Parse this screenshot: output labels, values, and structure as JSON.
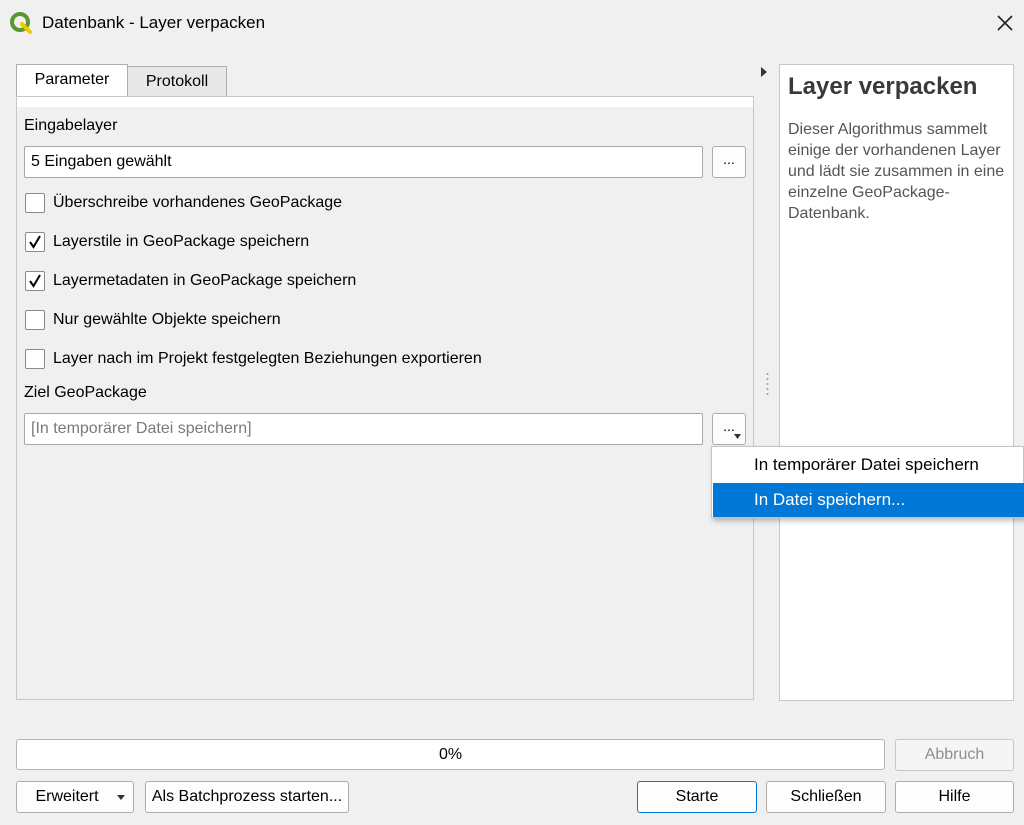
{
  "window": {
    "title": "Datenbank - Layer verpacken",
    "icon": "qgis-icon"
  },
  "tabs": [
    {
      "label": "Parameter",
      "active": true
    },
    {
      "label": "Protokoll",
      "active": false
    }
  ],
  "params": {
    "input_label": "Eingabelayer",
    "input_value": "5 Eingaben gewählt",
    "browse_label": "...",
    "checkboxes": [
      {
        "label": "Überschreibe vorhandenes GeoPackage",
        "checked": false
      },
      {
        "label": "Layerstile in GeoPackage speichern",
        "checked": true
      },
      {
        "label": "Layermetadaten in GeoPackage speichern",
        "checked": true
      },
      {
        "label": "Nur gewählte Objekte speichern",
        "checked": false
      },
      {
        "label": "Layer nach im Projekt festgelegten Beziehungen exportieren",
        "checked": false
      }
    ],
    "target_label": "Ziel GeoPackage",
    "target_placeholder": "[In temporärer Datei speichern]",
    "target_button_label": "..."
  },
  "dropdown_menu": {
    "items": [
      {
        "label": "In temporärer Datei speichern",
        "selected": false
      },
      {
        "label": "In Datei speichern...",
        "selected": true
      }
    ]
  },
  "help": {
    "title": "Layer verpacken",
    "body": "Dieser Algorithmus sammelt einige der vorhandenen Layer und lädt sie zusammen in eine einzelne GeoPackage-Datenbank."
  },
  "footer": {
    "progress_text": "0%",
    "progress_value": 0,
    "cancel_label": "Abbruch",
    "advanced_label": "Erweitert",
    "batch_label": "Als Batchprozess starten...",
    "run_label": "Starte",
    "close_label": "Schließen",
    "help_label": "Hilfe"
  },
  "colors": {
    "accent": "#0078d7",
    "qgis_green": "#589632",
    "qgis_yellow": "#eec900"
  }
}
